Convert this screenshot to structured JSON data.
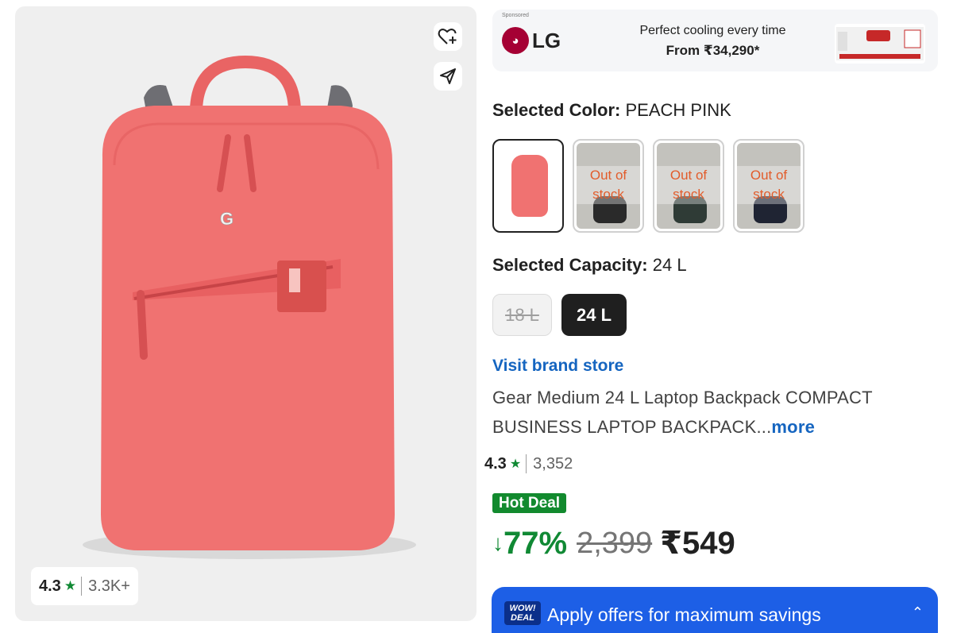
{
  "product_image": {
    "alt": "Peach pink laptop backpack",
    "rating": "4.3",
    "rating_count": "3.3K+",
    "icons": {
      "wishlist": "heart-plus-icon",
      "share": "share-icon",
      "star": "star-icon"
    }
  },
  "ad": {
    "sponsored": "Sponsored",
    "brand": "LG",
    "tagline": "Perfect cooling every time",
    "price": "From ₹34,290*"
  },
  "color": {
    "label": "Selected Color:",
    "value": "PEACH PINK",
    "options": [
      {
        "state": "selected"
      },
      {
        "state": "out_of_stock",
        "label": "Out of stock"
      },
      {
        "state": "out_of_stock",
        "label": "Out of stock"
      },
      {
        "state": "out_of_stock",
        "label": "Out of stock"
      }
    ]
  },
  "capacity": {
    "label": "Selected Capacity:",
    "value": "24 L",
    "options": [
      {
        "label": "18 L",
        "state": "unavailable"
      },
      {
        "label": "24 L",
        "state": "selected"
      }
    ]
  },
  "brand_store": "Visit brand store",
  "title": "Gear Medium 24 L Laptop Backpack COMPACT BUSINESS LAPTOP BACKPACK...",
  "title_more": "more",
  "rating": {
    "value": "4.3",
    "count": "3,352"
  },
  "hot_deal": "Hot Deal",
  "price": {
    "discount": "77%",
    "mrp": "2,399",
    "final": "₹549"
  },
  "offers": {
    "badge": "WOW! DEAL",
    "text": "Apply offers for maximum savings"
  },
  "colors": {
    "green": "#108934",
    "link_blue": "#1565c0",
    "offers_blue": "#1d5fe6",
    "bag_pink": "#f07271"
  }
}
